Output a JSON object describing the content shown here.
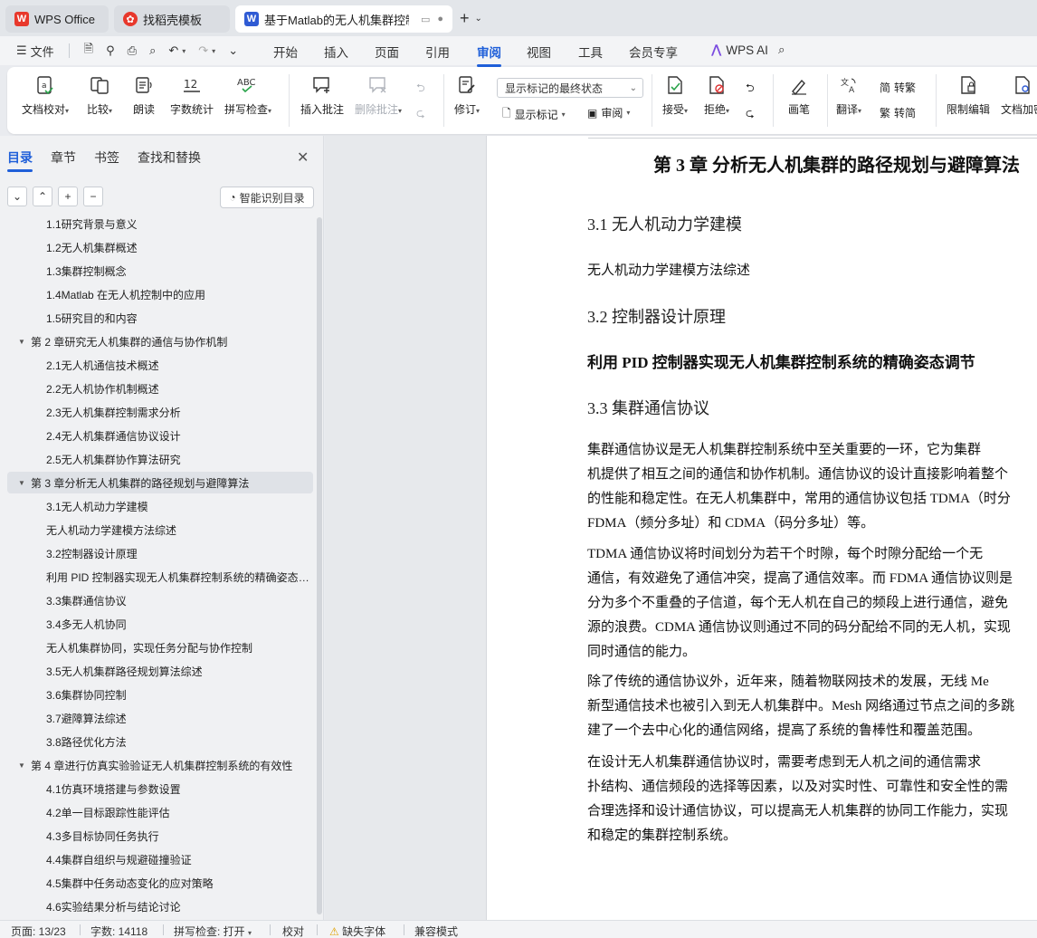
{
  "tabs": [
    {
      "label": "WPS Office"
    },
    {
      "label": "找稻壳模板"
    },
    {
      "label": "基于Matlab的无人机集群控制"
    }
  ],
  "menubar": {
    "file": "文件",
    "tabs": [
      "开始",
      "插入",
      "页面",
      "引用",
      "审阅",
      "视图",
      "工具",
      "会员专享"
    ],
    "active_tab": "审阅",
    "ai": "WPS AI"
  },
  "ribbon": {
    "doc_check": "文档校对",
    "compare": "比较",
    "read_aloud": "朗读",
    "word_count": "字数统计",
    "spell_check": "拼写检查",
    "spell_icon": "ABC",
    "word_count_icon": "12",
    "insert_comment": "插入批注",
    "delete_comment": "删除批注",
    "revise": "修订",
    "display_dropdown": "显示标记的最终状态",
    "show_marks": "显示标记",
    "review": "审阅",
    "accept": "接受",
    "reject": "拒绝",
    "pen": "画笔",
    "translate": "翻译",
    "to_traditional": "转繁",
    "to_simplified": "转简",
    "restrict_edit": "限制编辑",
    "doc_encrypt": "文档加密",
    "traditional_icon": "简",
    "simplified_icon": "繁"
  },
  "nav": {
    "tabs": [
      "目录",
      "章节",
      "书签",
      "查找和替换"
    ],
    "smart_toc": "智能识别目录",
    "items": [
      {
        "level": 2,
        "label": "1.1研究背景与意义"
      },
      {
        "level": 2,
        "label": "1.2无人机集群概述"
      },
      {
        "level": 2,
        "label": "1.3集群控制概念"
      },
      {
        "level": 2,
        "label": "1.4Matlab 在无人机控制中的应用"
      },
      {
        "level": 2,
        "label": "1.5研究目的和内容"
      },
      {
        "level": 1,
        "label": "第 2 章研究无人机集群的通信与协作机制"
      },
      {
        "level": 2,
        "label": "2.1无人机通信技术概述"
      },
      {
        "level": 2,
        "label": "2.2无人机协作机制概述"
      },
      {
        "level": 2,
        "label": "2.3无人机集群控制需求分析"
      },
      {
        "level": 2,
        "label": "2.4无人机集群通信协议设计"
      },
      {
        "level": 2,
        "label": "2.5无人机集群协作算法研究"
      },
      {
        "level": 1,
        "label": "第 3 章分析无人机集群的路径规划与避障算法",
        "selected": true
      },
      {
        "level": 2,
        "label": "3.1无人机动力学建模"
      },
      {
        "level": 2,
        "label": "无人机动力学建模方法综述"
      },
      {
        "level": 2,
        "label": "3.2控制器设计原理"
      },
      {
        "level": 2,
        "label": "利用 PID 控制器实现无人机集群控制系统的精确姿态调节"
      },
      {
        "level": 2,
        "label": "3.3集群通信协议"
      },
      {
        "level": 2,
        "label": "3.4多无人机协同"
      },
      {
        "level": 2,
        "label": "无人机集群协同，实现任务分配与协作控制"
      },
      {
        "level": 2,
        "label": "3.5无人机集群路径规划算法综述"
      },
      {
        "level": 2,
        "label": "3.6集群协同控制"
      },
      {
        "level": 2,
        "label": "3.7避障算法综述"
      },
      {
        "level": 2,
        "label": "3.8路径优化方法"
      },
      {
        "level": 1,
        "label": "第 4 章进行仿真实验验证无人机集群控制系统的有效性"
      },
      {
        "level": 2,
        "label": "4.1仿真环境搭建与参数设置"
      },
      {
        "level": 2,
        "label": "4.2单一目标跟踪性能评估"
      },
      {
        "level": 2,
        "label": "4.3多目标协同任务执行"
      },
      {
        "level": 2,
        "label": "4.4集群自组织与规避碰撞验证"
      },
      {
        "level": 2,
        "label": "4.5集群中任务动态变化的应对策略"
      },
      {
        "level": 2,
        "label": "4.6实验结果分析与结论讨论"
      }
    ]
  },
  "doc": {
    "chapter_title": "第 3 章    分析无人机集群的路径规划与避障算法",
    "s31": "3.1  无人机动力学建模",
    "s31_sub": "无人机动力学建模方法综述",
    "s32": "3.2  控制器设计原理",
    "s32_bold": "利用 PID 控制器实现无人机集群控制系统的精确姿态调节",
    "s33": "3.3  集群通信协议",
    "p1": [
      "        集群通信协议是无人机集群控制系统中至关重要的一环，它为集群",
      "机提供了相互之间的通信和协作机制。通信协议的设计直接影响着整个",
      "的性能和稳定性。在无人机集群中，常用的通信协议包括 TDMA（时分",
      "FDMA（频分多址）和 CDMA（码分多址）等。"
    ],
    "p2": [
      "        TDMA 通信协议将时间划分为若干个时隙，每个时隙分配给一个无",
      "通信，有效避免了通信冲突，提高了通信效率。而 FDMA 通信协议则是",
      "分为多个不重叠的子信道，每个无人机在自己的频段上进行通信，避免",
      "源的浪费。CDMA 通信协议则通过不同的码分配给不同的无人机，实现",
      "同时通信的能力。"
    ],
    "p3": [
      "        除了传统的通信协议外，近年来，随着物联网技术的发展，无线 Me",
      "新型通信技术也被引入到无人机集群中。Mesh 网络通过节点之间的多跳",
      "建了一个去中心化的通信网络，提高了系统的鲁棒性和覆盖范围。"
    ],
    "p4": [
      "        在设计无人机集群通信协议时，需要考虑到无人机之间的通信需求",
      "扑结构、通信频段的选择等因素，以及对实时性、可靠性和安全性的需",
      "合理选择和设计通信协议，可以提高无人机集群的协同工作能力，实现",
      "和稳定的集群控制系统。"
    ]
  },
  "status": {
    "page": "页面: 13/23",
    "words": "字数: 14118",
    "spell": "拼写检查: 打开",
    "proof": "校对",
    "missing_font": "缺失字体",
    "compat": "兼容模式"
  },
  "colors": {
    "accent": "#1f5fd9",
    "wps_red": "#e8382c",
    "word_blue": "#2f5bd4"
  }
}
